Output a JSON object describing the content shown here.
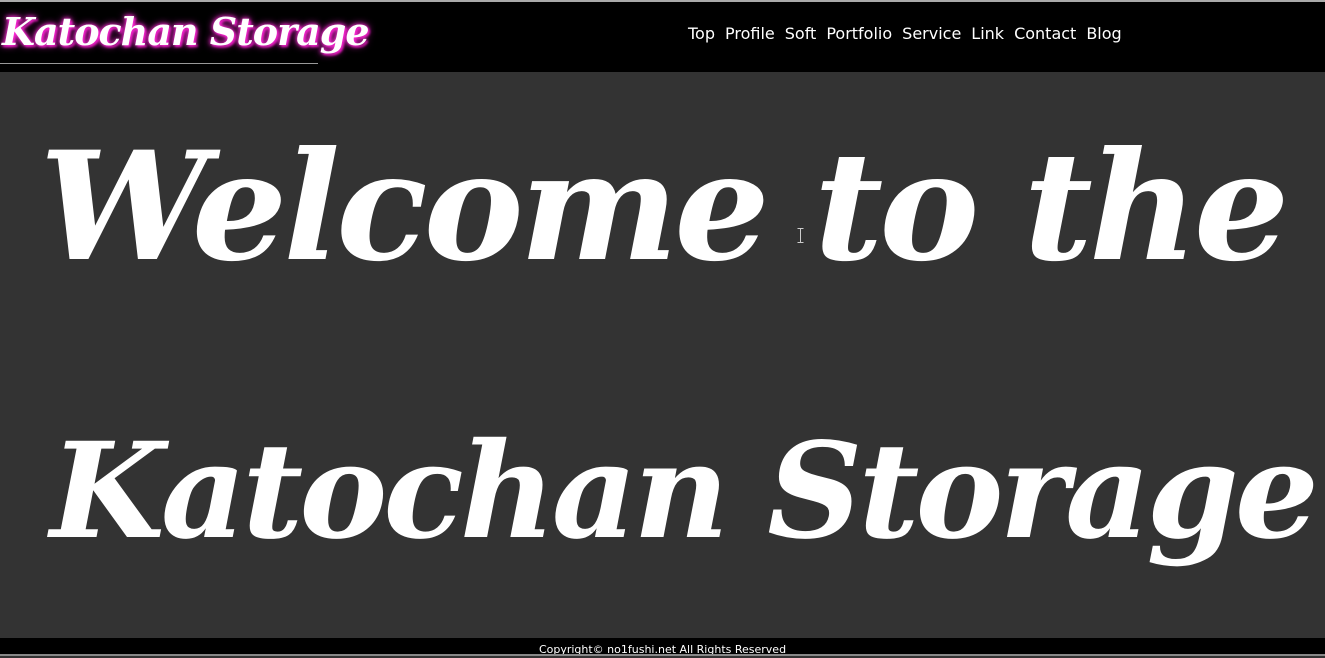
{
  "header": {
    "logo_text": "Katochan Storage",
    "nav": [
      {
        "label": "Top"
      },
      {
        "label": "Profile"
      },
      {
        "label": "Soft"
      },
      {
        "label": "Portfolio"
      },
      {
        "label": "Service"
      },
      {
        "label": "Link"
      },
      {
        "label": "Contact"
      },
      {
        "label": "Blog"
      }
    ]
  },
  "hero": {
    "line1": "Welcome to the",
    "line2": "Katochan Storage"
  },
  "footer": {
    "copyright": "Copyright© no1fushi.net All Rights Reserved"
  },
  "colors": {
    "header_bg": "#000000",
    "body_bg": "#333333",
    "text": "#ffffff",
    "logo_glow": "#ff2dd8"
  },
  "icons": {
    "cursor": "text-cursor-icon"
  }
}
